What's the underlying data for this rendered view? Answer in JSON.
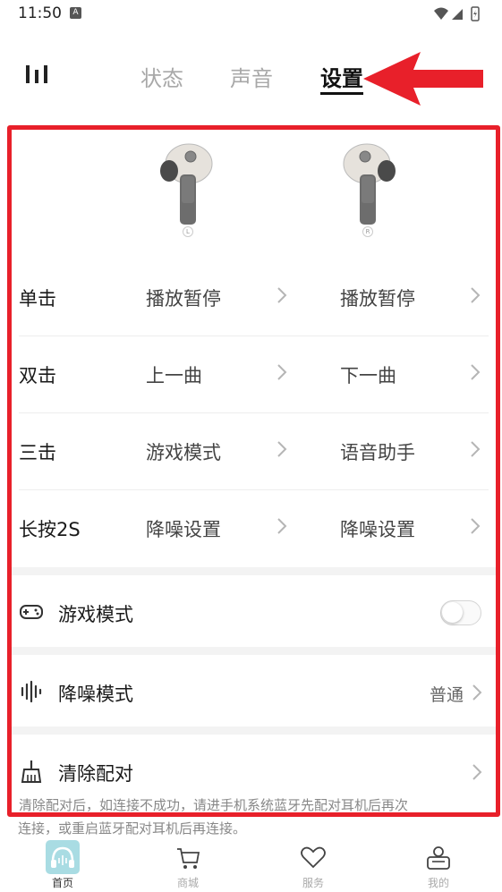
{
  "status_bar": {
    "time": "11:50",
    "app_badge": "A"
  },
  "top_nav": {
    "tabs": [
      {
        "label": "状态"
      },
      {
        "label": "声音"
      },
      {
        "label": "设置"
      }
    ],
    "active_tab": "设置"
  },
  "earbuds": {
    "left_label": "L",
    "right_label": "R"
  },
  "gestures": [
    {
      "name": "单击",
      "left": "播放暂停",
      "right": "播放暂停"
    },
    {
      "name": "双击",
      "left": "上一曲",
      "right": "下一曲"
    },
    {
      "name": "三击",
      "left": "游戏模式",
      "right": "语音助手"
    },
    {
      "name": "长按2S",
      "left": "降噪设置",
      "right": "降噪设置"
    }
  ],
  "settings": {
    "game_mode": {
      "label": "游戏模式",
      "enabled": false
    },
    "noise_mode": {
      "label": "降噪模式",
      "value": "普通"
    },
    "clear_pairing": {
      "label": "清除配对"
    }
  },
  "clear_note": {
    "line1": "清除配对后，如连接不成功，请进手机系统蓝牙先配对耳机后再次",
    "line2": "连接，或重启蓝牙配对耳机后再连接。"
  },
  "bottom_nav": [
    {
      "label": "首页",
      "icon": "home-headphones-icon"
    },
    {
      "label": "商城",
      "icon": "cart-icon"
    },
    {
      "label": "服务",
      "icon": "heart-icon"
    },
    {
      "label": "我的",
      "icon": "profile-icon"
    }
  ],
  "colors": {
    "accent_red": "#e8202a",
    "home_icon_bg": "#a9dce3"
  }
}
